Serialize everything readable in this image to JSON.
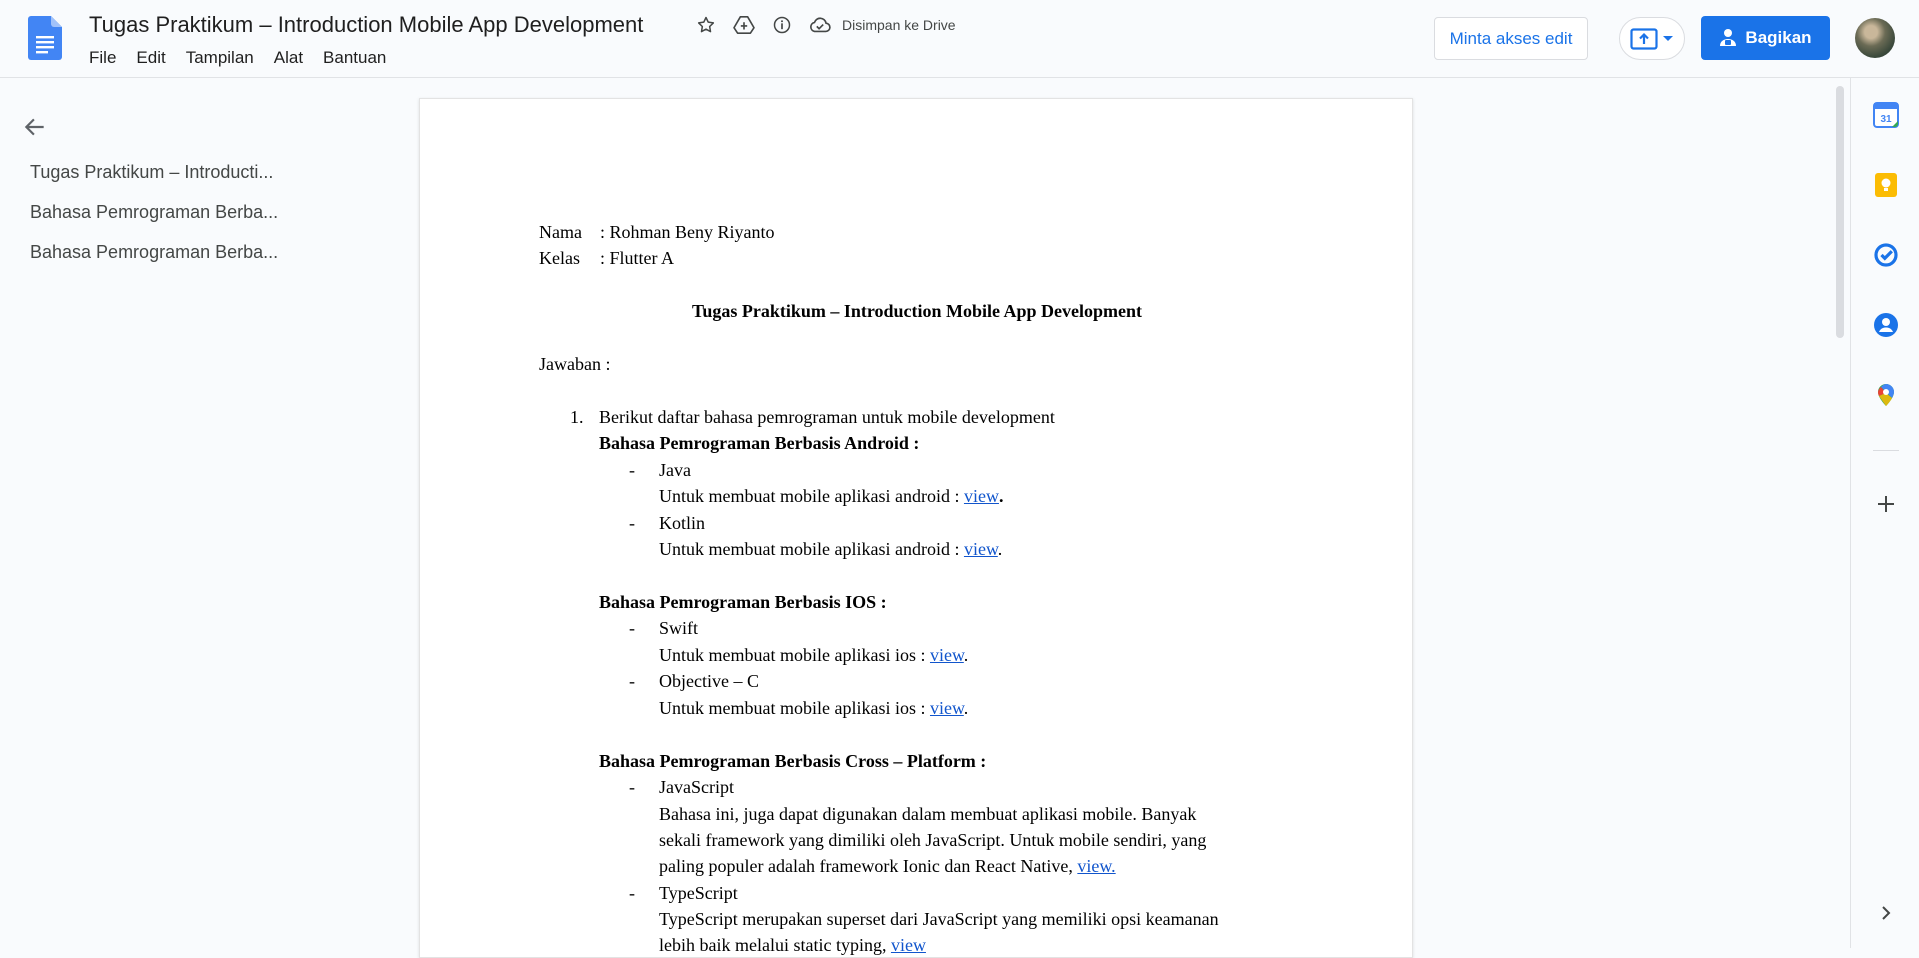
{
  "app": {
    "title": "Tugas Praktikum – Introduction Mobile App Development",
    "saved_status": "Disimpan ke Drive",
    "menu": [
      "File",
      "Edit",
      "Tampilan",
      "Alat",
      "Bantuan"
    ],
    "request_access_label": "Minta akses edit",
    "share_label": "Bagikan",
    "colors": {
      "accent": "#1a73e8",
      "link": "#1155cc",
      "background": "#f9fbfd"
    }
  },
  "outline": {
    "items": [
      "Tugas Praktikum – Introducti...",
      "Bahasa Pemrograman Berba...",
      "Bahasa Pemrograman Berba..."
    ]
  },
  "doc": {
    "nama_label": "Nama",
    "nama_value": ": Rohman Beny Riyanto",
    "kelas_label": "Kelas",
    "kelas_value": ": Flutter A",
    "heading": "Tugas Praktikum – Introduction Mobile App Development",
    "jawaban": "Jawaban :",
    "item_number": "1.",
    "item_text": "Berikut daftar bahasa pemrograman untuk mobile development",
    "android_heading": "Bahasa Pemrograman Berbasis Android :",
    "java": "Java",
    "java_desc": "Untuk membuat mobile aplikasi android : ",
    "kotlin": "Kotlin",
    "kotlin_desc": "Untuk membuat mobile aplikasi android : ",
    "ios_heading": "Bahasa Pemrograman Berbasis IOS :",
    "swift": "Swift",
    "swift_desc": "Untuk membuat mobile aplikasi ios : ",
    "objc": "Objective – C",
    "objc_desc": "Untuk membuat mobile aplikasi ios : ",
    "cross_heading": "Bahasa Pemrograman Berbasis Cross – Platform :",
    "js": "JavaScript",
    "js_desc_1": "Bahasa ini, juga dapat digunakan dalam membuat aplikasi mobile. Banyak",
    "js_desc_2": "sekali framework yang dimiliki oleh JavaScript. Untuk mobile sendiri, yang",
    "js_desc_3": "paling populer adalah framework Ionic dan React Native, ",
    "ts": "TypeScript",
    "ts_desc_1": "TypeScript merupakan superset dari JavaScript yang memiliki opsi keamanan",
    "ts_desc_2": "lebih baik melalui static typing, ",
    "view": "view",
    "view_dot": "view.",
    "dash": "-",
    "dot": "."
  }
}
